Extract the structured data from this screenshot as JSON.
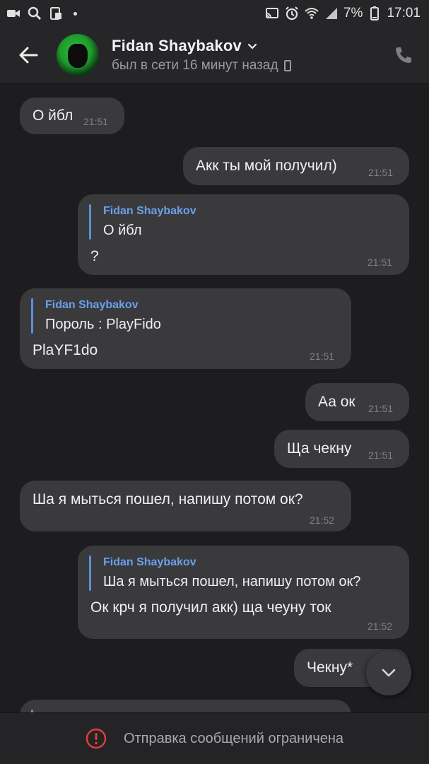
{
  "status_bar": {
    "battery_percent": "7%",
    "time": "17:01"
  },
  "header": {
    "contact_name": "Fidan Shaybakov",
    "last_seen": "был в сети 16 минут назад"
  },
  "messages": [
    {
      "direction": "in",
      "text": "О йбл",
      "time": "21:51"
    },
    {
      "direction": "out",
      "text": "Акк ты мой получил)",
      "time": "21:51"
    },
    {
      "direction": "out",
      "reply_name": "Fidan Shaybakov",
      "reply_text": "О йбл",
      "text": "?",
      "time": "21:51"
    },
    {
      "direction": "in",
      "reply_name": "Fidan Shaybakov",
      "reply_text": "Пороль : PlayFido",
      "text": "PlaYF1do",
      "time": "21:51"
    },
    {
      "direction": "out",
      "text": "Аа ок",
      "time": "21:51"
    },
    {
      "direction": "out",
      "text": "Ща чекну",
      "time": "21:51"
    },
    {
      "direction": "in",
      "text": "Ша я мыться пошел, напишу потом ок?",
      "time": "21:52"
    },
    {
      "direction": "out",
      "reply_name": "Fidan Shaybakov",
      "reply_text": "Ша я мыться пошел, напишу потом ок?",
      "text": "Ок крч я получил акк) ща чеуну ток",
      "time": "21:52"
    },
    {
      "direction": "out",
      "text": "Чекну*",
      "time": ""
    }
  ],
  "bottom_bar": {
    "restricted_text": "Отправка сообщений ограничена"
  },
  "colors": {
    "background": "#1d1d1f",
    "bubble": "#3a3a3d",
    "reply_accent": "#5a8fd8",
    "warning": "#e0403a"
  }
}
